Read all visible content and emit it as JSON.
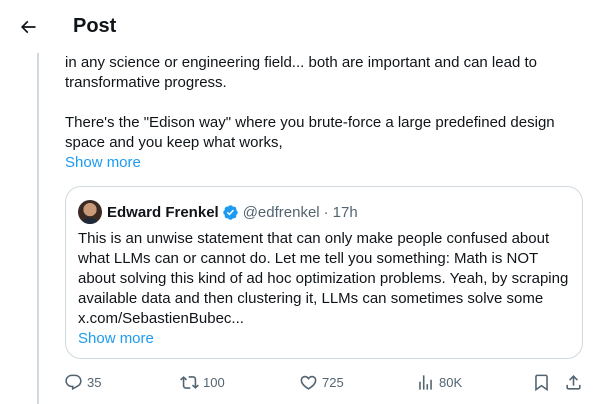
{
  "header": {
    "title": "Post"
  },
  "tweet": {
    "paragraph1": "in any science or engineering field... both are important and can lead to transformative progress.",
    "paragraph2": "There's the \"Edison way\" where you brute-force a large predefined design space and you keep what works,",
    "show_more": "Show more"
  },
  "quote": {
    "name": "Edward Frenkel",
    "handle": "@edfrenkel",
    "separator": "·",
    "time": "17h",
    "body": "This is an unwise statement that can only make people confused about what LLMs can or cannot do. Let me tell you something: Math is NOT about solving this kind of ad hoc optimization problems. Yeah, by scraping available data and then clustering it, LLMs can sometimes solve some x.com/SebastienBubec...",
    "show_more": "Show more"
  },
  "actions": {
    "replies": "35",
    "reposts": "100",
    "likes": "725",
    "views": "80K"
  },
  "colors": {
    "accent": "#1d9bf0",
    "muted": "#536471",
    "border": "#cfd9de",
    "text": "#0f1419"
  },
  "icons": [
    "back-arrow-icon",
    "verified-badge-icon",
    "reply-icon",
    "repost-icon",
    "like-icon",
    "views-icon",
    "bookmark-icon",
    "share-icon"
  ]
}
